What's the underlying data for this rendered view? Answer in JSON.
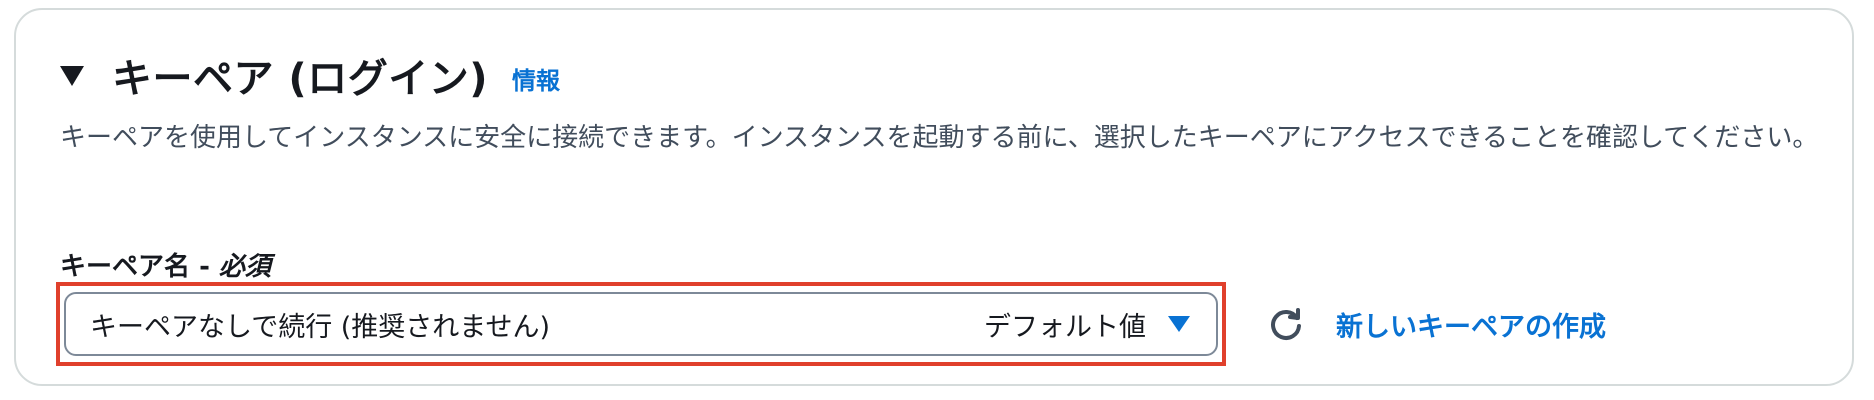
{
  "section": {
    "title": "キーペア (ログイン)",
    "info_link": "情報",
    "description": "キーペアを使用してインスタンスに安全に接続できます。インスタンスを起動する前に、選択したキーペアにアクセスできることを確認してください。"
  },
  "field": {
    "label": "キーペア名",
    "separator": " - ",
    "required": "必須"
  },
  "select": {
    "value": "キーペアなしで続行 (推奨されません)",
    "tag": "デフォルト値"
  },
  "actions": {
    "create_label": "新しいキーペアの作成"
  },
  "icons": {
    "collapse": "caret-down-icon",
    "dropdown": "dropdown-caret-icon",
    "refresh": "refresh-icon"
  },
  "colors": {
    "link": "#0972d3",
    "highlight": "#e0402c",
    "text": "#16191f"
  }
}
